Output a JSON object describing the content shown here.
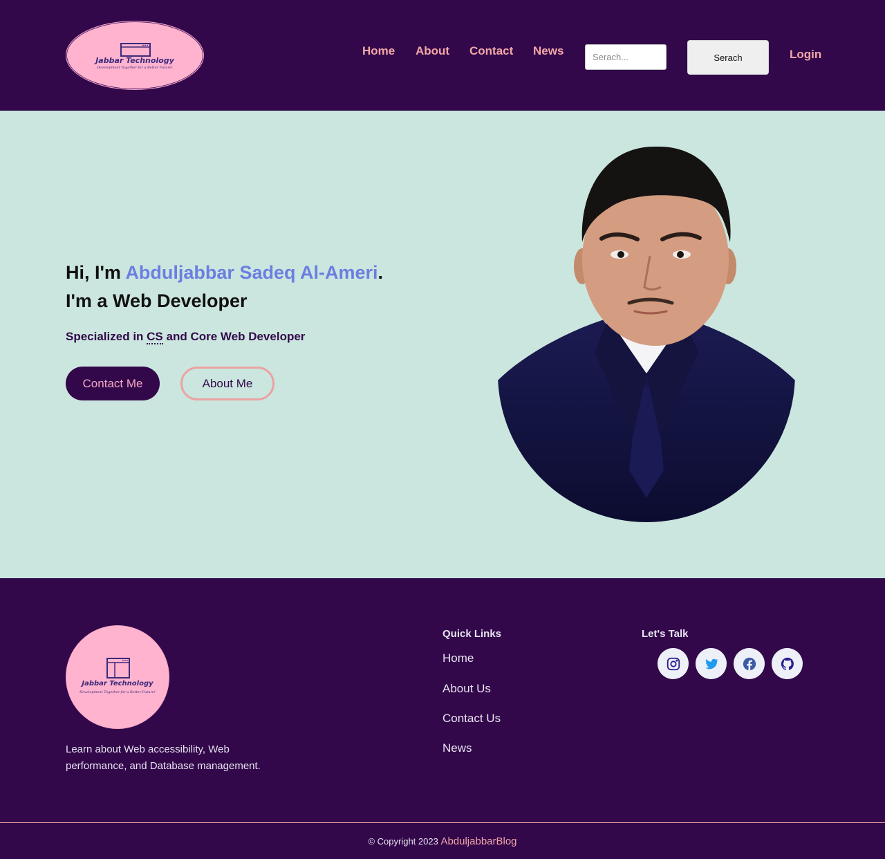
{
  "header": {
    "logo": {
      "brand": "Jabbar Technology",
      "tagline": "Development Together for a Better Future!"
    },
    "nav": [
      "Home",
      "About",
      "Contact",
      "News"
    ],
    "search": {
      "placeholder": "Serach...",
      "button": "Serach"
    },
    "login": "Login"
  },
  "hero": {
    "greeting": "Hi, I'm ",
    "name": "Abduljabbar Sadeq Al-Ameri",
    "period": ".",
    "role": "I'm a Web Developer",
    "specialized_prefix": "Specialized in ",
    "specialized_abbr": "CS",
    "specialized_suffix": " and Core Web Developer",
    "contact_button": "Contact Me",
    "about_button": "About Me"
  },
  "footer": {
    "logo": {
      "brand": "Jabbar Technology",
      "tagline": "Development Together for a Better Future!"
    },
    "description": "Learn about Web accessibility, Web performance, and Database management.",
    "quick_links_title": "Quick Links",
    "quick_links": [
      "Home",
      "About Us",
      "Contact Us",
      "News"
    ],
    "talk_title": "Let's Talk",
    "social": [
      "instagram-icon",
      "twitter-icon",
      "facebook-icon",
      "github-icon"
    ],
    "copyright": "© Copyright 2023 ",
    "site_name": "AbduljabbarBlog"
  },
  "colors": {
    "brand_dark": "#32084b",
    "accent_pink": "#f4a7a7",
    "hero_bg": "#cbe6de",
    "name_blue": "#6c7ee1"
  }
}
